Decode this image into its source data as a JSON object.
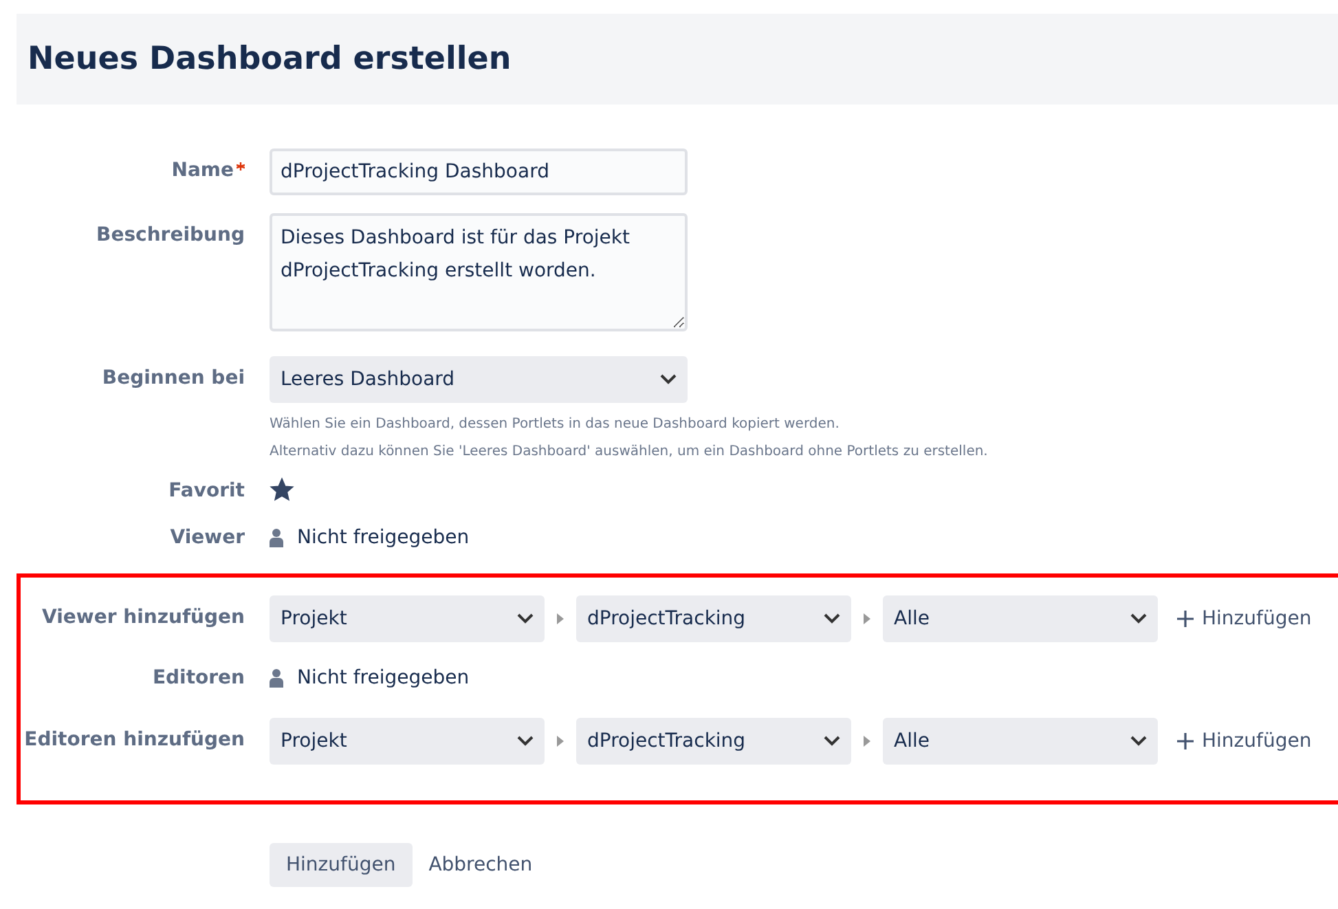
{
  "header": {
    "title": "Neues Dashboard erstellen"
  },
  "fields": [
    {
      "kind": "input",
      "label": "Name",
      "required": true,
      "value": "dProjectTracking Dashboard"
    },
    {
      "kind": "textarea",
      "label": "Beschreibung",
      "value": "Dieses Dashboard ist für das Projekt dProjectTracking erstellt worden."
    },
    {
      "kind": "select",
      "label": "Beginnen bei",
      "value": "Leeres Dashboard",
      "help": [
        "Wählen Sie ein Dashboard, dessen Portlets in das neue Dashboard kopiert werden.",
        "Alternativ dazu können Sie 'Leeres Dashboard' auswählen, um ein Dashboard ohne Portlets zu erstellen."
      ]
    },
    {
      "kind": "star",
      "label": "Favorit",
      "checked": true
    },
    {
      "kind": "sharing",
      "label": "Viewer",
      "value": "Nicht freigegeben"
    }
  ],
  "highlighted": [
    {
      "kind": "permission",
      "label": "Viewer hinzufügen",
      "selects": [
        "Projekt",
        "dProjectTracking",
        "Alle"
      ],
      "add": "Hinzufügen"
    },
    {
      "kind": "sharing",
      "label": "Editoren",
      "value": "Nicht freigegeben"
    },
    {
      "kind": "permission",
      "label": "Editoren hinzufügen",
      "selects": [
        "Projekt",
        "dProjectTracking",
        "Alle"
      ],
      "add": "Hinzufügen"
    }
  ],
  "buttons": [
    {
      "kind": "primary",
      "label": "Hinzufügen"
    },
    {
      "kind": "link",
      "label": "Abbrechen"
    }
  ]
}
